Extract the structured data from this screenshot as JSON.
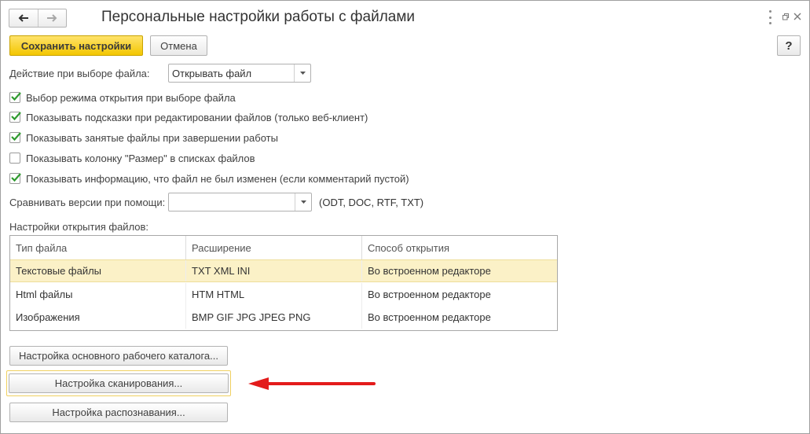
{
  "header": {
    "title": "Персональные настройки работы с файлами"
  },
  "toolbar": {
    "save_label": "Сохранить настройки",
    "cancel_label": "Отмена",
    "help_label": "?"
  },
  "file_action": {
    "label": "Действие при выборе файла:",
    "value": "Открывать файл"
  },
  "options": [
    {
      "label": "Выбор режима открытия при выборе файла",
      "checked": true
    },
    {
      "label": "Показывать подсказки при редактировании файлов (только веб-клиент)",
      "checked": true
    },
    {
      "label": "Показывать занятые файлы при завершении работы",
      "checked": true
    },
    {
      "label": "Показывать колонку \"Размер\" в списках файлов",
      "checked": false
    },
    {
      "label": "Показывать информацию, что файл не был изменен  (если комментарий пустой)",
      "checked": true
    }
  ],
  "compare": {
    "label": "Сравнивать версии при помощи:",
    "value": "",
    "hint": "(ODT, DOC, RTF, TXT)"
  },
  "table": {
    "title": "Настройки открытия файлов:",
    "columns": [
      "Тип файла",
      "Расширение",
      "Способ открытия"
    ],
    "rows": [
      {
        "type": "Текстовые файлы",
        "ext": "TXT XML INI",
        "method": "Во встроенном редакторе",
        "selected": true
      },
      {
        "type": "Html файлы",
        "ext": "HTM HTML",
        "method": "Во встроенном редакторе",
        "selected": false
      },
      {
        "type": "Изображения",
        "ext": "BMP GIF JPG JPEG PNG",
        "method": "Во встроенном редакторе",
        "selected": false
      }
    ]
  },
  "actions": {
    "working_dir_label": "Настройка основного рабочего каталога...",
    "scan_label": "Настройка сканирования...",
    "recognition_label": "Настройка распознавания..."
  },
  "colors": {
    "accent": "#f3c600",
    "check": "#2e9a2e",
    "arrow": "#e31b1b",
    "selected_row": "#fbf1c7"
  }
}
